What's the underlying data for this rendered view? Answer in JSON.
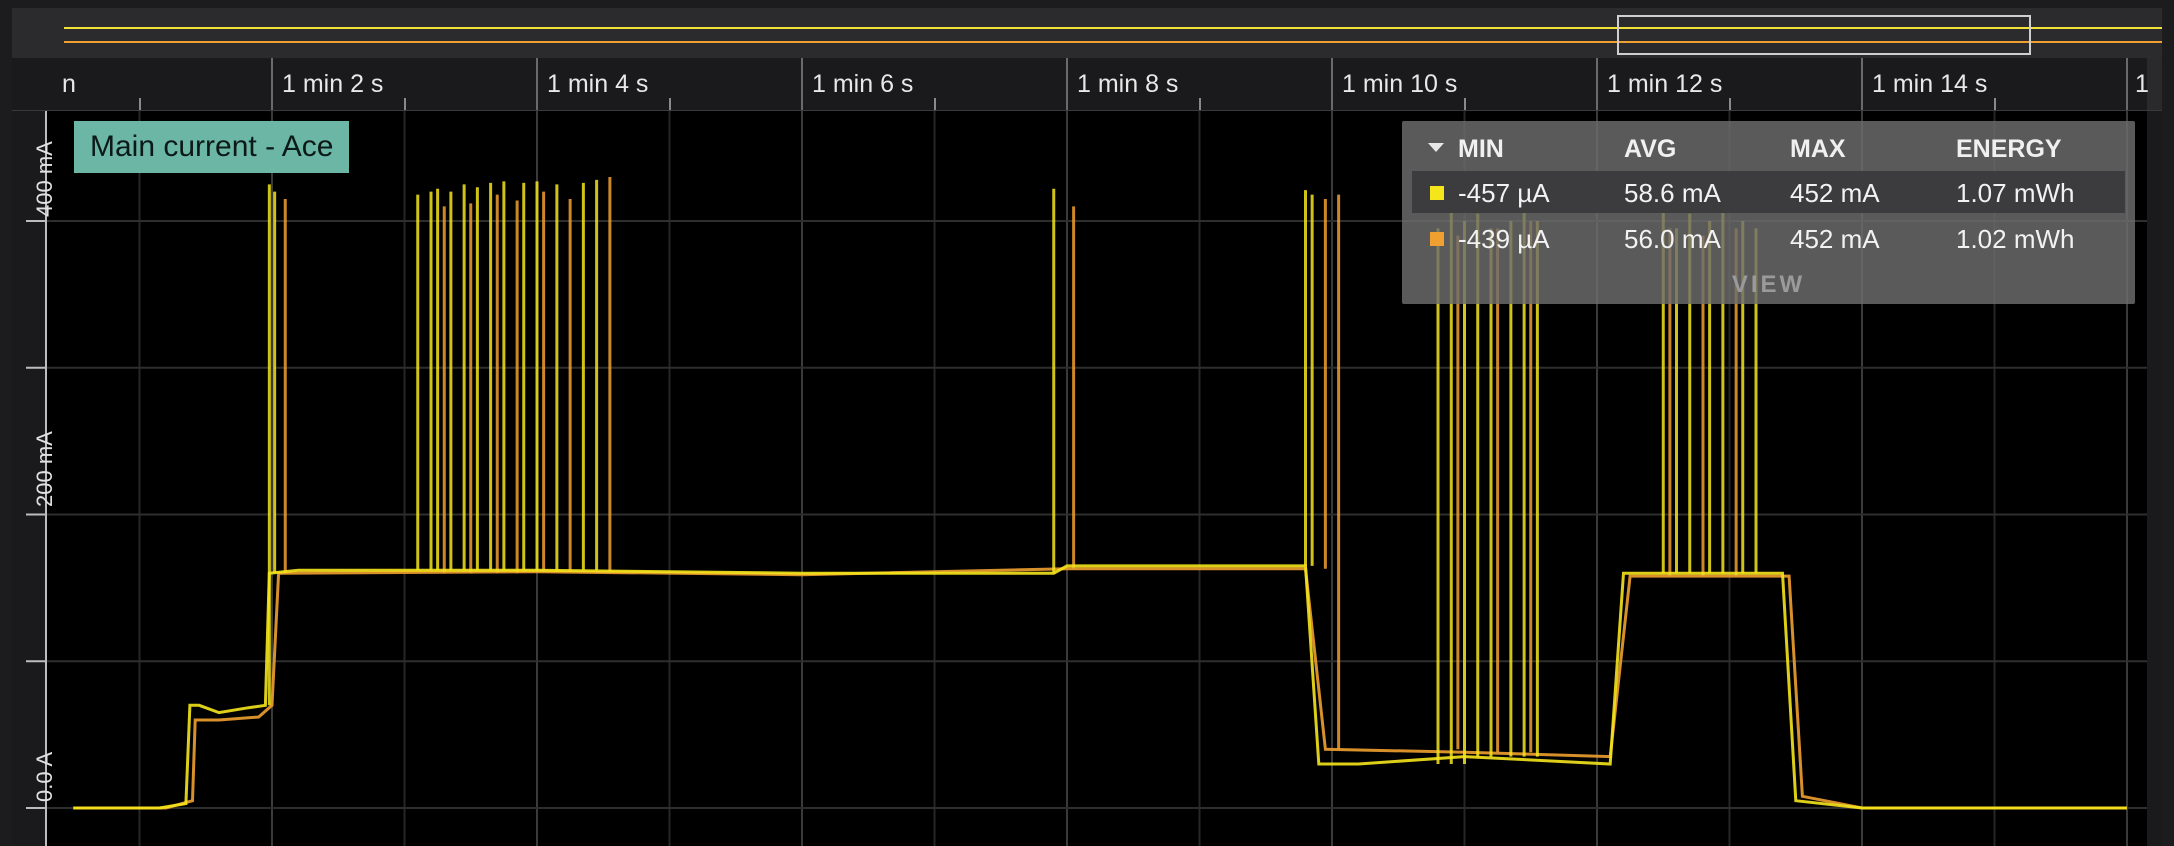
{
  "overview": {
    "trace_colors": [
      "#f2e23a",
      "#f0a030"
    ]
  },
  "time_axis": {
    "labels": [
      "n",
      "1 min 2 s",
      "1 min 4 s",
      "1 min 6 s",
      "1 min 8 s",
      "1 min 10 s",
      "1 min 12 s",
      "1 min 14 s",
      "1"
    ]
  },
  "y_axis": {
    "labels": [
      "400 mA",
      "200 mA",
      "0.0 A"
    ]
  },
  "channel": {
    "label": "Main current - Ace",
    "color": "#6cb6a6"
  },
  "stats": {
    "headers": {
      "min": "MIN",
      "avg": "AVG",
      "max": "MAX",
      "energy": "ENERGY"
    },
    "rows": [
      {
        "color": "#f5e61c",
        "min": "-457 µA",
        "avg": "58.6 mA",
        "max": "452 mA",
        "energy": "1.07 mWh"
      },
      {
        "color": "#f0a030",
        "min": "-439 µA",
        "avg": "56.0 mA",
        "max": "452 mA",
        "energy": "1.02 mWh"
      }
    ],
    "view_label": "VIEW"
  },
  "chart_data": {
    "type": "line",
    "title": "",
    "xlabel": "",
    "ylabel": "",
    "x_unit": "s",
    "xlim": [
      60.5,
      76.0
    ],
    "ylim": [
      -30,
      430
    ],
    "y_ticks": [
      0,
      200,
      400
    ],
    "y_tick_labels": [
      "0.0 A",
      "200 mA",
      "400 mA"
    ],
    "x_ticks": [
      60,
      62,
      64,
      66,
      68,
      70,
      72,
      74,
      76
    ],
    "grid": true,
    "series": [
      {
        "color": "#f5e61c",
        "baseline": [
          [
            60.5,
            0
          ],
          [
            61.15,
            0
          ],
          [
            61.35,
            3
          ],
          [
            61.38,
            70
          ],
          [
            61.45,
            70
          ],
          [
            61.6,
            65
          ],
          [
            61.8,
            68
          ],
          [
            61.95,
            70
          ],
          [
            61.98,
            160
          ],
          [
            62.2,
            162
          ],
          [
            64.0,
            162
          ],
          [
            66.0,
            160
          ],
          [
            67.9,
            160
          ],
          [
            68.0,
            165
          ],
          [
            69.8,
            165
          ],
          [
            69.9,
            30
          ],
          [
            70.2,
            30
          ],
          [
            71.0,
            35
          ],
          [
            72.1,
            30
          ],
          [
            72.2,
            160
          ],
          [
            73.4,
            160
          ],
          [
            73.5,
            5
          ],
          [
            74.0,
            0
          ],
          [
            76.0,
            0
          ]
        ],
        "spikes": [
          [
            61.98,
            425
          ],
          [
            62.02,
            420
          ],
          [
            63.1,
            418
          ],
          [
            63.2,
            420
          ],
          [
            63.25,
            422
          ],
          [
            63.35,
            420
          ],
          [
            63.45,
            425
          ],
          [
            63.55,
            423
          ],
          [
            63.65,
            426
          ],
          [
            63.75,
            427
          ],
          [
            63.9,
            426
          ],
          [
            64.0,
            427
          ],
          [
            64.15,
            425
          ],
          [
            64.35,
            426
          ],
          [
            64.45,
            428
          ],
          [
            67.9,
            422
          ],
          [
            69.8,
            421
          ],
          [
            69.85,
            418
          ],
          [
            70.8,
            395
          ],
          [
            70.9,
            410
          ],
          [
            71.0,
            400
          ],
          [
            71.1,
            405
          ],
          [
            71.2,
            395
          ],
          [
            71.35,
            400
          ],
          [
            71.45,
            410
          ],
          [
            71.55,
            400
          ],
          [
            72.5,
            410
          ],
          [
            72.6,
            395
          ],
          [
            72.7,
            405
          ],
          [
            72.85,
            400
          ],
          [
            72.95,
            410
          ],
          [
            73.1,
            400
          ],
          [
            73.2,
            395
          ]
        ]
      },
      {
        "color": "#f0a030",
        "baseline": [
          [
            60.5,
            0
          ],
          [
            61.2,
            0
          ],
          [
            61.4,
            5
          ],
          [
            61.42,
            60
          ],
          [
            61.6,
            60
          ],
          [
            61.9,
            62
          ],
          [
            62.0,
            70
          ],
          [
            62.05,
            160
          ],
          [
            64.0,
            161
          ],
          [
            66.0,
            159
          ],
          [
            68.0,
            163
          ],
          [
            69.8,
            163
          ],
          [
            69.95,
            40
          ],
          [
            71.0,
            38
          ],
          [
            72.1,
            35
          ],
          [
            72.25,
            158
          ],
          [
            73.45,
            158
          ],
          [
            73.55,
            8
          ],
          [
            74.0,
            0
          ],
          [
            76.0,
            0
          ]
        ],
        "spikes": [
          [
            62.1,
            415
          ],
          [
            63.3,
            410
          ],
          [
            63.5,
            412
          ],
          [
            63.7,
            418
          ],
          [
            63.85,
            414
          ],
          [
            64.05,
            420
          ],
          [
            64.25,
            415
          ],
          [
            64.55,
            430
          ],
          [
            68.05,
            410
          ],
          [
            69.95,
            415
          ],
          [
            70.05,
            418
          ],
          [
            70.95,
            390
          ],
          [
            71.25,
            395
          ],
          [
            71.5,
            400
          ],
          [
            72.55,
            395
          ],
          [
            72.8,
            390
          ],
          [
            73.05,
            395
          ]
        ]
      }
    ]
  }
}
